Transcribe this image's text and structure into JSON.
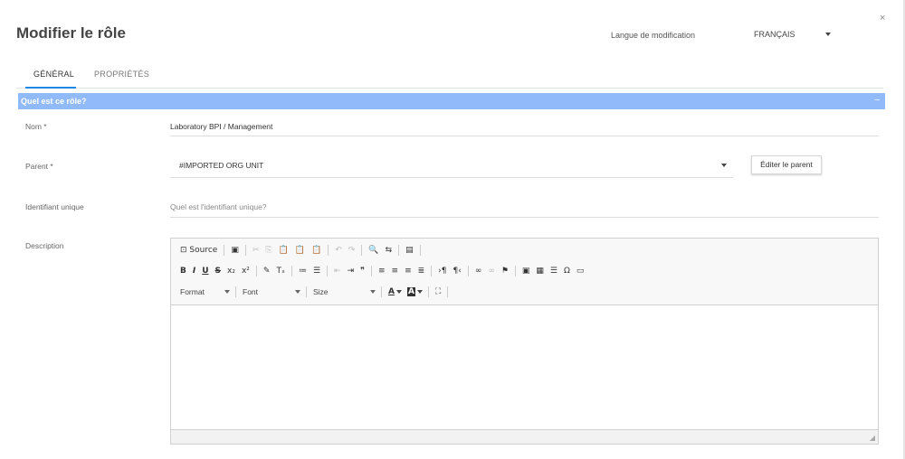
{
  "dialog": {
    "title": "Modifier le rôle",
    "close": "×"
  },
  "language": {
    "label": "Langue de modification",
    "selected": "FRANÇAIS"
  },
  "tabs": [
    {
      "label": "GÉNÉRAL",
      "active": true
    },
    {
      "label": "PROPRIÉTÉS",
      "active": false
    }
  ],
  "section": {
    "title": "Quel est ce rôle?",
    "collapse": "–",
    "bar_color": "#90baf9"
  },
  "fields": {
    "name": {
      "label": "Nom *",
      "value": "Laboratory BPI / Management"
    },
    "parent": {
      "label": "Parent *",
      "value": "#IMPORTED ORG UNIT",
      "edit_button": "Éditer le parent"
    },
    "unique_id": {
      "label": "Identifiant unique",
      "placeholder": "Quel est l'identifiant unique?"
    },
    "description": {
      "label": "Description"
    }
  },
  "editor": {
    "row1": [
      {
        "icon": "source-icon",
        "glyph": "⊡ Source"
      },
      "sep",
      {
        "icon": "save-icon",
        "glyph": "▣"
      },
      "sep",
      {
        "icon": "cut-icon",
        "glyph": "✂",
        "disabled": true
      },
      {
        "icon": "copy-icon",
        "glyph": "⎘",
        "disabled": true
      },
      {
        "icon": "paste-icon",
        "glyph": "📋"
      },
      {
        "icon": "paste-text-icon",
        "glyph": "📋"
      },
      {
        "icon": "paste-word-icon",
        "glyph": "📋"
      },
      "sep",
      {
        "icon": "undo-icon",
        "glyph": "↶",
        "disabled": true
      },
      {
        "icon": "redo-icon",
        "glyph": "↷",
        "disabled": true
      },
      "sep",
      {
        "icon": "find-icon",
        "glyph": "🔍"
      },
      {
        "icon": "replace-icon",
        "glyph": "⇆"
      },
      "sep",
      {
        "icon": "select-all-icon",
        "glyph": "▤"
      },
      "sep"
    ],
    "row2": [
      {
        "icon": "bold-icon",
        "glyph": "B",
        "style": "b"
      },
      {
        "icon": "italic-icon",
        "glyph": "I",
        "style": "i"
      },
      {
        "icon": "underline-icon",
        "glyph": "U",
        "style": "u"
      },
      {
        "icon": "strike-icon",
        "glyph": "S",
        "style": "s"
      },
      {
        "icon": "subscript-icon",
        "glyph": "x₂"
      },
      {
        "icon": "superscript-icon",
        "glyph": "x²"
      },
      "sep",
      {
        "icon": "copy-format-icon",
        "glyph": "✎"
      },
      {
        "icon": "remove-format-icon",
        "glyph": "Tₓ"
      },
      "sep",
      {
        "icon": "numbered-list-icon",
        "glyph": "≔"
      },
      {
        "icon": "bulleted-list-icon",
        "glyph": "☰"
      },
      "sep",
      {
        "icon": "outdent-icon",
        "glyph": "⇤",
        "disabled": true
      },
      {
        "icon": "indent-icon",
        "glyph": "⇥"
      },
      {
        "icon": "blockquote-icon",
        "glyph": "❞"
      },
      "sep",
      {
        "icon": "align-left-icon",
        "glyph": "≡"
      },
      {
        "icon": "align-center-icon",
        "glyph": "≡"
      },
      {
        "icon": "align-right-icon",
        "glyph": "≡"
      },
      {
        "icon": "align-justify-icon",
        "glyph": "≣"
      },
      "sep",
      {
        "icon": "ltr-icon",
        "glyph": "›¶"
      },
      {
        "icon": "rtl-icon",
        "glyph": "¶‹"
      },
      "sep",
      {
        "icon": "link-icon",
        "glyph": "∞"
      },
      {
        "icon": "unlink-icon",
        "glyph": "∞",
        "disabled": true
      },
      {
        "icon": "anchor-icon",
        "glyph": "⚑"
      },
      "sep",
      {
        "icon": "image-icon",
        "glyph": "▣"
      },
      {
        "icon": "table-icon",
        "glyph": "▦"
      },
      {
        "icon": "horizontal-line-icon",
        "glyph": "☰"
      },
      {
        "icon": "special-char-icon",
        "glyph": "Ω"
      },
      {
        "icon": "iframe-icon",
        "glyph": "▭"
      }
    ],
    "row3": {
      "format": "Format",
      "font": "Font",
      "size": "Size",
      "text_color": "A",
      "bg_color": "A",
      "maximize": "⛶"
    },
    "resize": "◢"
  }
}
